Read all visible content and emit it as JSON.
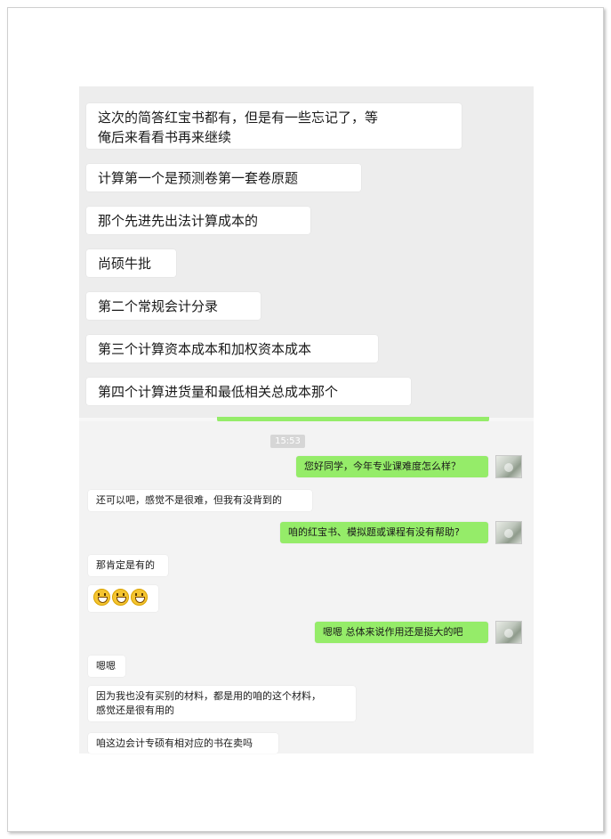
{
  "top_messages": [
    {
      "text": "这次的简答红宝书都有，但是有一些忘记了，等俺后来看看书再来继续",
      "line1": "这次的简答红宝书都有，但是有一些忘记了，等",
      "line2": "俺后来看看书再来继续"
    },
    {
      "text": "计算第一个是预测卷第一套卷原题"
    },
    {
      "text": "那个先进先出法计算成本的"
    },
    {
      "text": "尚硕牛批"
    },
    {
      "text": "第二个常规会计分录"
    },
    {
      "text": "第三个计算资本成本和加权资本成本"
    },
    {
      "text": "第四个计算进货量和最低相关总成本那个"
    }
  ],
  "time_badge": "15:53",
  "bottom_messages": [
    {
      "side": "right",
      "text": "您好同学，今年专业课难度怎么样？"
    },
    {
      "side": "left",
      "text": "还可以吧，感觉不是很难，但我有没背到的"
    },
    {
      "side": "right",
      "text": "咱的红宝书、模拟题或课程有没有帮助?"
    },
    {
      "side": "left",
      "text": "那肯定是有的"
    },
    {
      "side": "left",
      "emoji": [
        "grin-emoji",
        "grin-emoji",
        "grin-emoji"
      ]
    },
    {
      "side": "right",
      "text": "嗯嗯 总体来说作用还是挺大的吧"
    },
    {
      "side": "left",
      "text": "嗯嗯"
    },
    {
      "side": "left",
      "line1": "因为我也没有买别的材料，都是用的咱的这个材料，",
      "line2": "感觉还是很有用的"
    },
    {
      "side": "left",
      "text": "咱这边会计专硕有相对应的书在卖吗"
    }
  ],
  "colors": {
    "sent_bubble": "#95ec69",
    "received_bubble": "#ffffff",
    "chat_bg": "#ededed"
  }
}
